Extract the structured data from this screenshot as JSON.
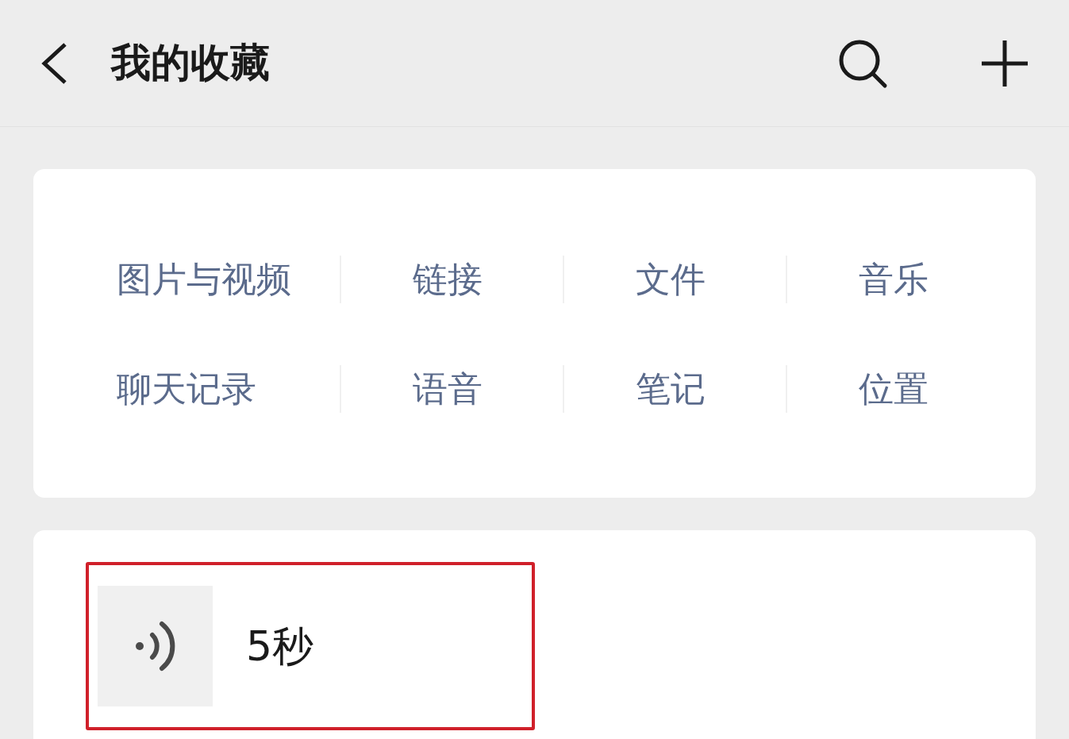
{
  "header": {
    "title": "我的收藏"
  },
  "categories": [
    {
      "label": "图片与视频"
    },
    {
      "label": "链接"
    },
    {
      "label": "文件"
    },
    {
      "label": "音乐"
    },
    {
      "label": "聊天记录"
    },
    {
      "label": "语音"
    },
    {
      "label": "笔记"
    },
    {
      "label": "位置"
    }
  ],
  "items": [
    {
      "kind": "voice",
      "duration": "5秒",
      "highlighted": true
    }
  ]
}
